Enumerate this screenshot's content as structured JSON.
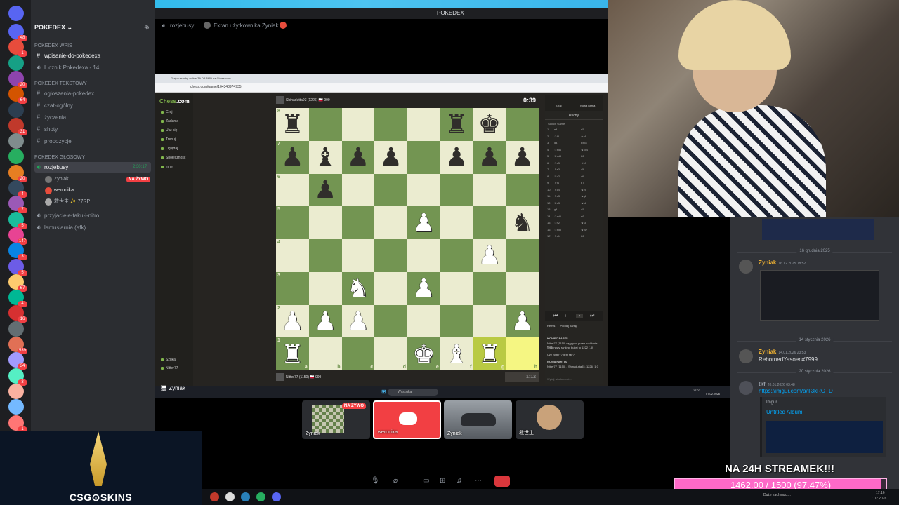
{
  "window": {
    "title": "POKEDEX",
    "accent": "#5865f2"
  },
  "servers": [
    {
      "badge": "48"
    },
    {
      "badge": "1"
    },
    {
      "badge": ""
    },
    {
      "badge": "20"
    },
    {
      "badge": "64"
    },
    {
      "badge": ""
    },
    {
      "badge": "31"
    },
    {
      "badge": ""
    },
    {
      "badge": ""
    },
    {
      "badge": "20"
    },
    {
      "badge": "4"
    },
    {
      "badge": "7"
    },
    {
      "badge": "5"
    },
    {
      "badge": "147"
    },
    {
      "badge": "3"
    },
    {
      "badge": "5"
    },
    {
      "badge": "67"
    },
    {
      "badge": "4"
    },
    {
      "badge": "16"
    },
    {
      "badge": ""
    },
    {
      "badge": "539"
    },
    {
      "badge": "34"
    },
    {
      "badge": "3"
    },
    {
      "badge": ""
    },
    {
      "badge": ""
    },
    {
      "badge": "1"
    }
  ],
  "sidebar": {
    "server_name": "POKEDEX",
    "categories": [
      {
        "name": "POKEDEX Wpis",
        "channels": [
          {
            "label": "wpisanie-do-pokedexa",
            "active": false,
            "bright": true
          },
          {
            "label": "Licznik Pokedexa - 14",
            "active": false,
            "bright": false
          }
        ]
      },
      {
        "name": "POKEDEX Tekstowy",
        "channels": [
          {
            "label": "ogłoszenia-pokedex"
          },
          {
            "label": "czat-ogólny"
          },
          {
            "label": "życzenia"
          },
          {
            "label": "shoty"
          },
          {
            "label": "propozycje"
          }
        ]
      },
      {
        "name": "POKEDEX GŁOSOWY",
        "voice_active": {
          "label": "rozjebusy",
          "timer": "2:30:17",
          "live": "NA ŻYWO"
        },
        "voice_users": [
          {
            "name": "Zyniak"
          },
          {
            "name": "weronika"
          },
          {
            "name": "救世主 ✨ 77RP"
          }
        ],
        "channels_after": [
          {
            "label": "przyjaciele-taku-i-nitro"
          },
          {
            "label": "lamusiarnia (afk)"
          }
        ]
      }
    ]
  },
  "stream_header": {
    "channel": "rozjebusy",
    "screen_label": "Ekran użytkownika Zyniak"
  },
  "browser": {
    "tab_title": "Graj w szachy online ZA DARMO na Chess.com",
    "url": "chess.com/game/104348974935"
  },
  "chess_nav": {
    "logo_a": "Chess",
    "logo_b": ".com",
    "items": [
      "Graj",
      "Zadania",
      "Ucz się",
      "Trenuj",
      "Oglądaj",
      "Społeczność",
      "Inne"
    ],
    "bottom_items": [
      "Szukaj",
      "Nitter77"
    ]
  },
  "players": {
    "top": {
      "name": "Shinadutta93 (1226) 🇵🇱 999",
      "clock": "0:39"
    },
    "bottom": {
      "name": "Nitter77 (1150) 🇵🇱 999",
      "clock": "1:12"
    }
  },
  "board": {
    "rows": [
      [
        "br",
        "",
        "",
        "",
        "",
        "br",
        "bk",
        ""
      ],
      [
        "bp",
        "bb",
        "bp",
        "bp",
        "",
        "bp",
        "bp",
        "bp"
      ],
      [
        "",
        "bp",
        "",
        "",
        "",
        "",
        "",
        ""
      ],
      [
        "",
        "",
        "",
        "",
        "wp",
        "",
        "",
        "bn"
      ],
      [
        "",
        "",
        "",
        "",
        "",
        "",
        "wp",
        ""
      ],
      [
        "",
        "",
        "wn",
        "",
        "wp",
        "",
        "",
        ""
      ],
      [
        "wp",
        "wp",
        "wp",
        "",
        "",
        "",
        "",
        "wp"
      ],
      [
        "wr",
        "",
        "",
        "",
        "wk",
        "wb",
        "wr",
        ""
      ]
    ],
    "highlights": [
      [
        7,
        6
      ],
      [
        7,
        7
      ]
    ],
    "files": [
      "a",
      "b",
      "c",
      "d",
      "e",
      "f",
      "g",
      "h"
    ],
    "ranks": [
      "8",
      "7",
      "6",
      "5",
      "4",
      "3",
      "2",
      "1"
    ],
    "colors": {
      "light": "#ebecd0",
      "dark": "#739552"
    }
  },
  "panel": {
    "tabs": [
      "Graj",
      "Nowa partia"
    ],
    "subtab": "Ruchy",
    "opening": "Scotch Game",
    "moves": [
      [
        "1.",
        "e4",
        "e5"
      ],
      [
        "2.",
        "♘f3",
        "♞c6"
      ],
      [
        "3.",
        "d4",
        "exd4"
      ],
      [
        "4.",
        "♘xd4",
        "♞xd4"
      ],
      [
        "5.",
        "♕xd4",
        "b6"
      ],
      [
        "6.",
        "♘c3",
        "♝b7"
      ],
      [
        "7.",
        "♗e3",
        "c5"
      ],
      [
        "8.",
        "♕d2",
        "c6"
      ],
      [
        "9.",
        "♗f4",
        "e7"
      ],
      [
        "10.",
        "♗c4",
        "♞e5"
      ],
      [
        "11.",
        "♗e3",
        "♞g6"
      ],
      [
        "12.",
        "♕e3",
        "♞h6"
      ],
      [
        "13.",
        "g4",
        "d5"
      ],
      [
        "14.",
        "♘xd5",
        "e6"
      ],
      [
        "15.",
        "♘h2",
        "♞f3"
      ],
      [
        "16.",
        "♘xd5",
        "♞f4+"
      ],
      [
        "17.",
        "♗xf4",
        "b6"
      ]
    ],
    "tools": [
      "Remis",
      "Poddaj partię"
    ],
    "log_title": "KONIEC PARTII",
    "log_lines": [
      "Nitter77 (1150) wygrywa przez poddanie (+9)",
      "Twój nowy ranking bullet to 1222 (-8)",
      "Czy Nitter77 grał fair?",
      "NOWA PARTIA",
      "Nitter77 (1150) - Shinadutta93 (1226) 1 0"
    ],
    "chat_placeholder": "Wyślij wiadomość..."
  },
  "taskbar": {
    "search": "Wyszukaj",
    "time": "17:02",
    "date": "07.02.2026"
  },
  "thumbs": [
    {
      "label": "Zyniak",
      "live": "NA ŻYWO"
    },
    {
      "label": "weronika"
    },
    {
      "label": "Zyniak"
    },
    {
      "label": "救世主"
    }
  ],
  "chat": {
    "dates": [
      "16 grudnia 2025",
      "14 stycznia 2026",
      "20 stycznia 2026"
    ],
    "messages": [
      {
        "author": "Zyniak",
        "time": "16.12.2025 18:52",
        "text": "",
        "author_color": "#f0b232"
      },
      {
        "author": "Zyniak",
        "time": "14.01.2026 23:53",
        "text": "RebornedYasoen#7999",
        "author_color": "#f0b232"
      },
      {
        "author": "tkf",
        "time": "20.01.2026 03:48",
        "text": "https://imgur.com/a/T3kROTD",
        "author_color": "#949ba4",
        "embed_provider": "Imgur",
        "embed_title": "Untitled Album"
      }
    ]
  },
  "sponsor": {
    "text": "CSG⊙SKINS"
  },
  "goal": {
    "title": "NA 24H STREAMEK!!!",
    "current": 1462.0,
    "target": 1500,
    "text": "1462.00 / 1500 (97.47%)",
    "progress": 0.9747,
    "fill_color": "#ff69c8"
  },
  "system_tray": {
    "weather": "Duże zachmurz...",
    "time": "17:16",
    "date": "7.02.2026"
  }
}
